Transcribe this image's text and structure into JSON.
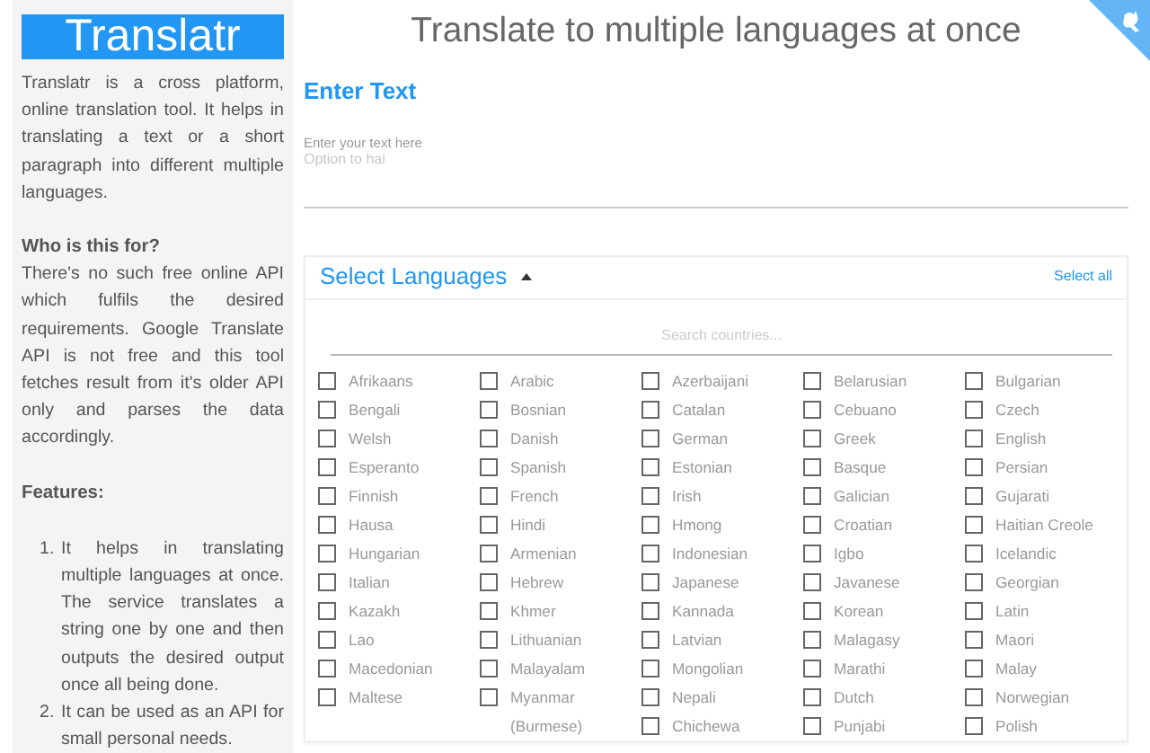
{
  "sidebar": {
    "logo": "Translatr",
    "intro": "Translatr is a cross platform, online translation tool. It helps in translating a text or a short paragraph into different multiple languages.",
    "sections": [
      {
        "heading": "Who is this for?",
        "body": "There's no such free online API which fulfils the desired requirements. Google Translate API is not free and this tool fetches result from it's older API only and parses the data accordingly."
      },
      {
        "heading": "Features:",
        "list": [
          {
            "number": "1.",
            "text": "It helps in translating multiple languages at once. The service translates a string one by one and then outputs the desired output once all being done."
          },
          {
            "number": "2.",
            "text": "It can be used as an API for small personal needs."
          }
        ]
      }
    ]
  },
  "main": {
    "title": "Translate to multiple languages at once",
    "enter_text": {
      "heading": "Enter Text",
      "label": "Enter your text here",
      "placeholder": "Option to hai"
    },
    "languages": {
      "heading": "Select Languages",
      "expanded": true,
      "select_all": "Select all",
      "search": {
        "placeholder": "Search countries..."
      },
      "items": [
        {
          "label": "Afrikaans",
          "checked": false
        },
        {
          "label": "Arabic",
          "checked": false
        },
        {
          "label": "Azerbaijani",
          "checked": false
        },
        {
          "label": "Belarusian",
          "checked": false
        },
        {
          "label": "Bulgarian",
          "checked": false
        },
        {
          "label": "Bengali",
          "checked": false
        },
        {
          "label": "Bosnian",
          "checked": false
        },
        {
          "label": "Catalan",
          "checked": false
        },
        {
          "label": "Cebuano",
          "checked": false
        },
        {
          "label": "Czech",
          "checked": false
        },
        {
          "label": "Welsh",
          "checked": false
        },
        {
          "label": "Danish",
          "checked": false
        },
        {
          "label": "German",
          "checked": false
        },
        {
          "label": "Greek",
          "checked": false
        },
        {
          "label": "English",
          "checked": false
        },
        {
          "label": "Esperanto",
          "checked": false
        },
        {
          "label": "Spanish",
          "checked": false
        },
        {
          "label": "Estonian",
          "checked": false
        },
        {
          "label": "Basque",
          "checked": false
        },
        {
          "label": "Persian",
          "checked": false
        },
        {
          "label": "Finnish",
          "checked": false
        },
        {
          "label": "French",
          "checked": false
        },
        {
          "label": "Irish",
          "checked": false
        },
        {
          "label": "Galician",
          "checked": false
        },
        {
          "label": "Gujarati",
          "checked": false
        },
        {
          "label": "Hausa",
          "checked": false
        },
        {
          "label": "Hindi",
          "checked": false
        },
        {
          "label": "Hmong",
          "checked": false
        },
        {
          "label": "Croatian",
          "checked": false
        },
        {
          "label": "Haitian Creole",
          "checked": false
        },
        {
          "label": "Hungarian",
          "checked": false
        },
        {
          "label": "Armenian",
          "checked": false
        },
        {
          "label": "Indonesian",
          "checked": false
        },
        {
          "label": "Igbo",
          "checked": false
        },
        {
          "label": "Icelandic",
          "checked": false
        },
        {
          "label": "Italian",
          "checked": false
        },
        {
          "label": "Hebrew",
          "checked": false
        },
        {
          "label": "Japanese",
          "checked": false
        },
        {
          "label": "Javanese",
          "checked": false
        },
        {
          "label": "Georgian",
          "checked": false
        },
        {
          "label": "Kazakh",
          "checked": false
        },
        {
          "label": "Khmer",
          "checked": false
        },
        {
          "label": "Kannada",
          "checked": false
        },
        {
          "label": "Korean",
          "checked": false
        },
        {
          "label": "Latin",
          "checked": false
        },
        {
          "label": "Lao",
          "checked": false
        },
        {
          "label": "Lithuanian",
          "checked": false
        },
        {
          "label": "Latvian",
          "checked": false
        },
        {
          "label": "Malagasy",
          "checked": false
        },
        {
          "label": "Maori",
          "checked": false
        },
        {
          "label": "Macedonian",
          "checked": false
        },
        {
          "label": "Malayalam",
          "checked": false
        },
        {
          "label": "Mongolian",
          "checked": false
        },
        {
          "label": "Marathi",
          "checked": false
        },
        {
          "label": "Malay",
          "checked": false
        },
        {
          "label": "Maltese",
          "checked": false
        },
        {
          "label": "Myanmar (Burmese)",
          "checked": false
        },
        {
          "label": "Nepali",
          "checked": false
        },
        {
          "label": "Dutch",
          "checked": false
        },
        {
          "label": "Norwegian",
          "checked": false
        },
        {
          "label": "Chichewa",
          "checked": false
        },
        {
          "label": "Punjabi",
          "checked": false
        },
        {
          "label": "Polish",
          "checked": false
        }
      ]
    }
  }
}
